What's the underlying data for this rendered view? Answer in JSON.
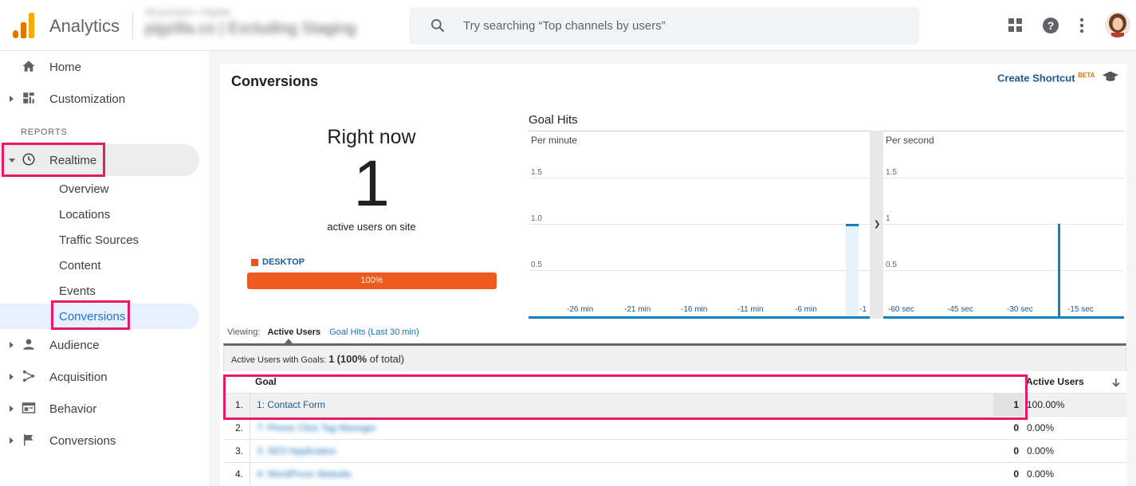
{
  "app": {
    "name": "Analytics",
    "account_path": "All accounts > Pigzilla",
    "property": "pigzilla.co | Excluding Staging"
  },
  "search": {
    "placeholder": "Try searching “Top channels by users”"
  },
  "colors": {
    "accent_blue": "#1a5a96",
    "highlight": "#e8196b",
    "desktop": "#ed5b1f",
    "chart_line": "#0a82c0"
  },
  "sidebar": {
    "items_top": [
      {
        "label": "Home",
        "icon": "home-icon"
      },
      {
        "label": "Customization",
        "icon": "dashboard-icon"
      }
    ],
    "section_label": "REPORTS",
    "realtime": {
      "label": "Realtime",
      "icon": "clock-icon",
      "children": [
        "Overview",
        "Locations",
        "Traffic Sources",
        "Content",
        "Events",
        "Conversions"
      ],
      "active_child": "Conversions"
    },
    "items_bottom": [
      {
        "label": "Audience",
        "icon": "person-icon"
      },
      {
        "label": "Acquisition",
        "icon": "acquisition-icon"
      },
      {
        "label": "Behavior",
        "icon": "behavior-icon"
      },
      {
        "label": "Conversions",
        "icon": "flag-icon"
      }
    ]
  },
  "page": {
    "title": "Conversions",
    "shortcut_label": "Create Shortcut",
    "shortcut_badge": "BETA"
  },
  "right_now": {
    "title": "Right now",
    "value": "1",
    "subtitle": "active users on site",
    "device_label": "DESKTOP",
    "device_percent": "100%"
  },
  "goal_hits": {
    "title": "Goal Hits"
  },
  "chart_data": [
    {
      "type": "bar",
      "title": "Per minute",
      "yticks": [
        "1.5",
        "1.0",
        "0.5"
      ],
      "xticks": [
        "-26 min",
        "-21 min",
        "-16 min",
        "-11 min",
        "-6 min",
        "-1"
      ],
      "ylim": [
        0,
        2
      ],
      "x": [
        "-1"
      ],
      "values": [
        1
      ]
    },
    {
      "type": "bar",
      "title": "Per second",
      "yticks": [
        "1.5",
        "1",
        "0.5"
      ],
      "xticks": [
        "-60 sec",
        "-45 sec",
        "-30 sec",
        "-15 sec"
      ],
      "ylim": [
        0,
        2
      ],
      "x": [
        "-15 sec"
      ],
      "values": [
        1
      ]
    }
  ],
  "viewing": {
    "label": "Viewing:",
    "active_tab": "Active Users",
    "other_tab": "Goal Hits (Last 30 min)"
  },
  "summary": {
    "label": "Active Users with Goals:",
    "value": "1",
    "pct_open": "(",
    "pct": "100%",
    "pct_rest": " of total)"
  },
  "table": {
    "headers": {
      "goal": "Goal",
      "active": "Active Users"
    },
    "rows": [
      {
        "idx": "1.",
        "goal": "1: Contact Form",
        "count": "1",
        "pct": "100.00%"
      },
      {
        "idx": "2.",
        "goal": "7: Phone Click Tag Manager",
        "count": "0",
        "pct": "0.00%"
      },
      {
        "idx": "3.",
        "goal": "3: SEO Application",
        "count": "0",
        "pct": "0.00%"
      },
      {
        "idx": "4.",
        "goal": "4: WordPress Website",
        "count": "0",
        "pct": "0.00%"
      }
    ]
  }
}
